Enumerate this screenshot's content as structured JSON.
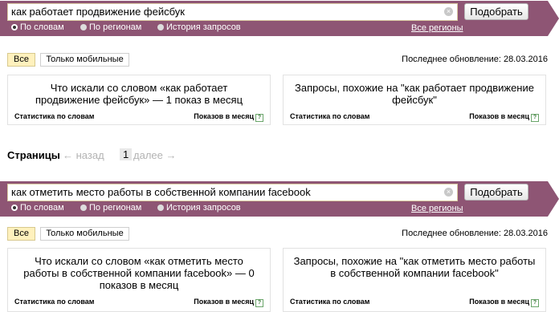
{
  "blocks": [
    {
      "query": "как работает продвижение фейсбук",
      "submit_label": "Подобрать",
      "radios": [
        "По словам",
        "По регионам",
        "История запросов"
      ],
      "regions_link": "Все регионы",
      "tabs": [
        "Все",
        "Только мобильные"
      ],
      "updated": "Последнее обновление: 28.03.2016",
      "left_card": {
        "title_line1": "Что искали со словом «как работает",
        "title_line2": "продвижение фейсбук» — 1 показ в месяц",
        "title_line3": "",
        "footer_left": "Статистика по словам",
        "footer_right": "Показов в месяц"
      },
      "right_card": {
        "title_line1": "Запросы, похожие на \"как работает продвижение",
        "title_line2": "фейсбук\"",
        "footer_left": "Статистика по словам",
        "footer_right": "Показов в месяц"
      }
    },
    {
      "query": "как отметить место работы в собственной компании facebook",
      "submit_label": "Подобрать",
      "radios": [
        "По словам",
        "По регионам",
        "История запросов"
      ],
      "regions_link": "Все регионы",
      "tabs": [
        "Все",
        "Только мобильные"
      ],
      "updated": "Последнее обновление: 28.03.2016",
      "left_card": {
        "title_line1": "Что искали со словом «как отметить место",
        "title_line2": "работы в собственной компании facebook» — 0",
        "title_line3": "показов в месяц",
        "footer_left": "Статистика по словам",
        "footer_right": "Показов в месяц"
      },
      "right_card": {
        "title_line1": "Запросы, похожие на \"как отметить место работы",
        "title_line2": "в собственной компании facebook\"",
        "footer_left": "Статистика по словам",
        "footer_right": "Показов в месяц"
      }
    }
  ],
  "pager": {
    "label": "Страницы",
    "prev": "← назад",
    "current": "1",
    "next": "далее →"
  },
  "icons": {
    "clear": "clear-icon",
    "help": "help-icon"
  },
  "colors": {
    "banner": "#8e5574",
    "active_tab": "#fff1bd"
  }
}
